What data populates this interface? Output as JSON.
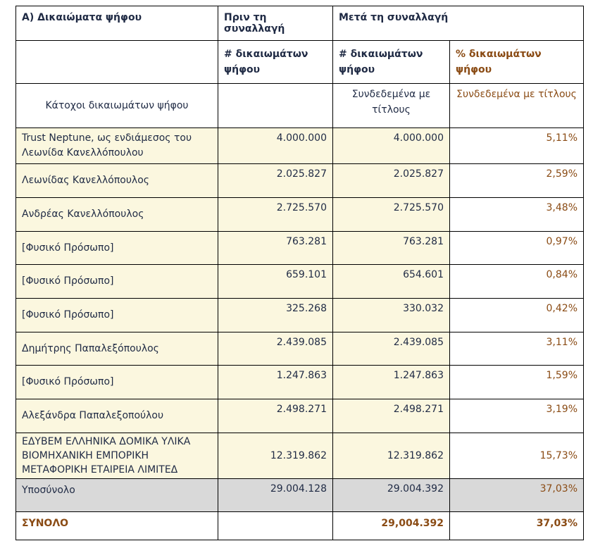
{
  "header": {
    "section_title": "Α) Δικαιώματα ψήφου",
    "before_label": "Πριν τη συναλλαγή",
    "after_label": "Μετά τη συναλλαγή",
    "count_label_before": "# δικαιωμάτων ψήφου",
    "count_label_after": "# δικαιωμάτων ψήφου",
    "pct_label": "% δικαιωμάτων ψήφου",
    "holders_label": "Κάτοχοι δικαιωμάτων ψήφου",
    "linked_label_after": "Συνδεδεμένα με τίτλους",
    "linked_label_pct": "Συνδεδεμένα με τίτλους"
  },
  "rows": [
    {
      "name": "Trust Neptune, ως ενδιάμεσος του Λεωνίδα Κανελλόπουλου",
      "before": "4.000.000",
      "after": "4.000.000",
      "pct": "5,11%"
    },
    {
      "name": "Λεωνίδας Κανελλόπουλος",
      "before": "2.025.827",
      "after": "2.025.827",
      "pct": "2,59%"
    },
    {
      "name": "Ανδρέας Κανελλόπουλος",
      "before": "2.725.570",
      "after": "2.725.570",
      "pct": "3,48%"
    },
    {
      "name": "[Φυσικό Πρόσωπο]",
      "before": "763.281",
      "after": "763.281",
      "pct": "0,97%"
    },
    {
      "name": "[Φυσικό Πρόσωπο]",
      "before": "659.101",
      "after": "654.601",
      "pct": "0,84%"
    },
    {
      "name": "[Φυσικό Πρόσωπο]",
      "before": "325.268",
      "after": "330.032",
      "pct": "0,42%"
    },
    {
      "name": "Δημήτρης Παπαλεξόπουλος",
      "before": "2.439.085",
      "after": "2.439.085",
      "pct": "3,11%"
    },
    {
      "name": "[Φυσικό Πρόσωπο]",
      "before": "1.247.863",
      "after": "1.247.863",
      "pct": "1,59%"
    },
    {
      "name": "Αλεξάνδρα Παπαλεξοπούλου",
      "before": "2.498.271",
      "after": "2.498.271",
      "pct": "3,19%"
    },
    {
      "name": "ΕΔΥΒΕΜ ΕΛΛΗΝΙΚΑ ΔΟΜΙΚΑ ΥΛΙΚΑ ΒΙΟΜΗΧΑΝΙΚΗ ΕΜΠΟΡΙΚΗ ΜΕΤΑΦΟΡΙΚΗ ΕΤΑΙΡΕΙΑ ΛΙΜΙΤΕΔ",
      "before": "12.319.862",
      "after": "12.319.862",
      "pct": "15,73%"
    }
  ],
  "subtotal": {
    "label": "Υποσύνολο",
    "before": "29.004.128",
    "after": "29.004.392",
    "pct": "37,03%"
  },
  "total": {
    "label": "ΣΥΝΟΛΟ",
    "before": "",
    "after": "29,004.392",
    "pct": "37,03%"
  },
  "colors": {
    "text": "#1f2a44",
    "accent_brown": "#8a4b14",
    "row_fill": "#fbf7df",
    "subtotal_fill": "#d9d9d9"
  }
}
